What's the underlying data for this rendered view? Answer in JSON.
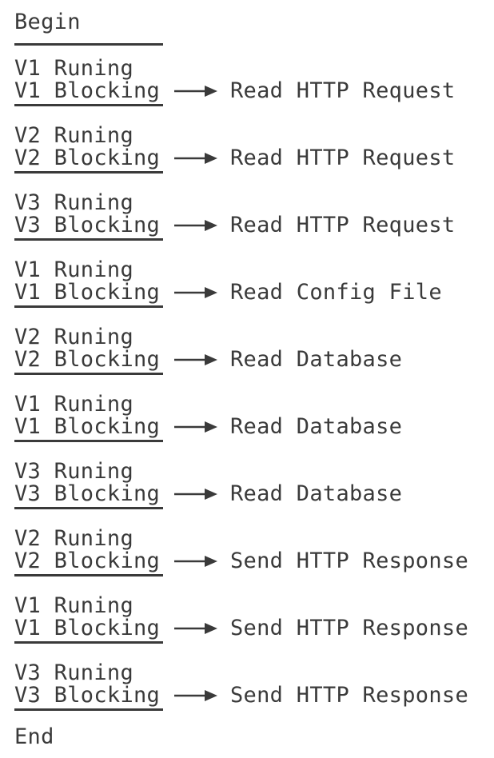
{
  "begin_label": "Begin",
  "end_label": "End",
  "steps": [
    {
      "running": "V1 Runing",
      "blocking": "V1 Blocking",
      "action": "Read HTTP Request"
    },
    {
      "running": "V2 Runing",
      "blocking": "V2 Blocking",
      "action": "Read HTTP Request"
    },
    {
      "running": "V3 Runing",
      "blocking": "V3 Blocking",
      "action": "Read HTTP Request"
    },
    {
      "running": "V1 Runing",
      "blocking": "V1 Blocking",
      "action": "Read Config File"
    },
    {
      "running": "V2 Runing",
      "blocking": "V2 Blocking",
      "action": "Read Database"
    },
    {
      "running": "V1 Runing",
      "blocking": "V1 Blocking",
      "action": "Read Database"
    },
    {
      "running": "V3 Runing",
      "blocking": "V3 Blocking",
      "action": "Read Database"
    },
    {
      "running": "V2 Runing",
      "blocking": "V2 Blocking",
      "action": "Send HTTP Response"
    },
    {
      "running": "V1 Runing",
      "blocking": "V1 Blocking",
      "action": "Send HTTP Response"
    },
    {
      "running": "V3 Runing",
      "blocking": "V3 Blocking",
      "action": "Send HTTP Response"
    }
  ],
  "colors": {
    "text": "#3a3a3a",
    "background": "#ffffff"
  },
  "icons": {
    "arrow": "right-arrow-icon"
  }
}
